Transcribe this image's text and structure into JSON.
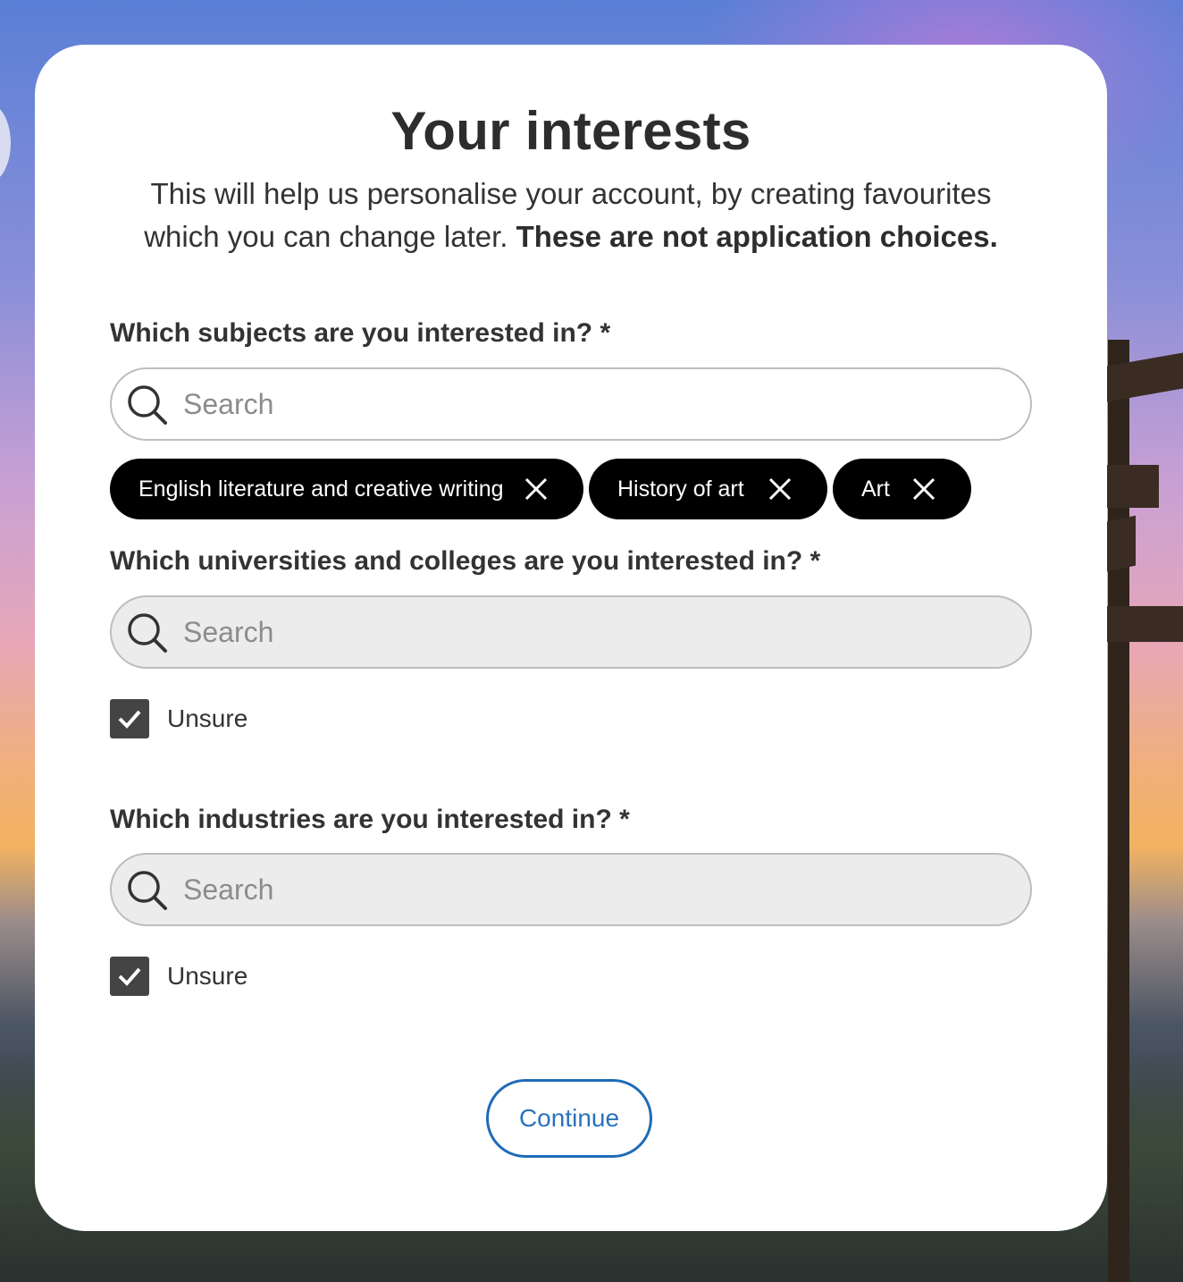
{
  "page": {
    "title": "Your interests",
    "intro_text": "This will help us personalise your account, by creating favourites which you can change later.",
    "intro_bold": "These are not application choices."
  },
  "subjects": {
    "label": "Which subjects are you interested in? *",
    "search_placeholder": "Search",
    "selected": [
      "English literature and creative writing",
      "History of art",
      "Art"
    ]
  },
  "universities": {
    "label": "Which universities and colleges are you interested in? *",
    "search_placeholder": "Search",
    "unsure_label": "Unsure",
    "unsure_checked": true
  },
  "industries": {
    "label": "Which industries are you interested in? *",
    "search_placeholder": "Search",
    "unsure_label": "Unsure",
    "unsure_checked": true
  },
  "actions": {
    "continue_label": "Continue"
  },
  "colors": {
    "chip_background": "#000000",
    "continue_accent": "#1f6bb8",
    "checkbox_fill": "#444444"
  }
}
